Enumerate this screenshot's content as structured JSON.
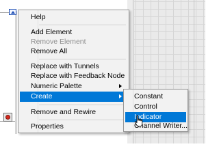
{
  "context_menu": {
    "items": [
      {
        "label": "Help",
        "enabled": true
      },
      {
        "label": "Add Element",
        "enabled": true
      },
      {
        "label": "Remove Element",
        "enabled": false
      },
      {
        "label": "Remove All",
        "enabled": true
      },
      {
        "label": "Replace with Tunnels",
        "enabled": true
      },
      {
        "label": "Replace with Feedback Node",
        "enabled": true
      },
      {
        "label": "Numeric Palette",
        "enabled": true,
        "submenu": true
      },
      {
        "label": "Create",
        "enabled": true,
        "submenu": true,
        "highlighted": true
      },
      {
        "label": "Remove and Rewire",
        "enabled": true
      },
      {
        "label": "Properties",
        "enabled": true
      }
    ]
  },
  "create_submenu": {
    "items": [
      {
        "label": "Constant"
      },
      {
        "label": "Control"
      },
      {
        "label": "Indicator",
        "highlighted": true
      },
      {
        "label": "Channel Writer..."
      }
    ]
  },
  "colors": {
    "highlight": "#0078d7",
    "menu_background": "#f2f2f2",
    "disabled_text": "#8d8d8d"
  },
  "icons": {
    "terminal": "input-terminal-icon",
    "stop": "stop-button-icon",
    "cursor": "hand-pointer-icon"
  }
}
